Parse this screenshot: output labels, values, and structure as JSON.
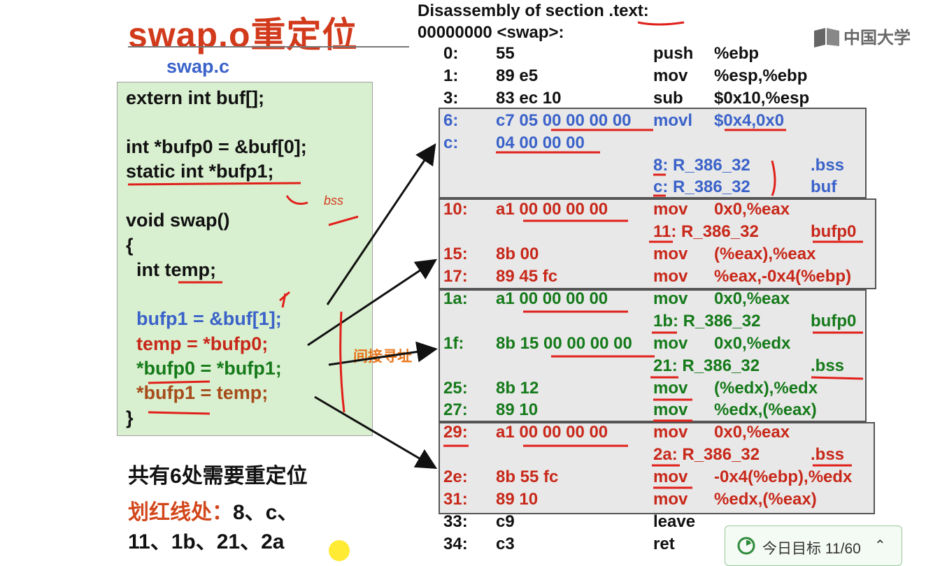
{
  "slide": {
    "title": "swap.o重定位",
    "file_label": "swap.c",
    "code_lines": [
      {
        "text": "extern int buf[];",
        "color": "black"
      },
      {
        "text": "",
        "color": "black"
      },
      {
        "text": "int *bufp0 = &buf[0];",
        "color": "black"
      },
      {
        "text": "static int *bufp1;",
        "color": "black"
      },
      {
        "text": "",
        "color": "black"
      },
      {
        "text": "void swap()",
        "color": "black"
      },
      {
        "text": "{",
        "color": "black"
      },
      {
        "text": "  int temp;",
        "color": "black"
      },
      {
        "text": "",
        "color": "black"
      },
      {
        "text": "  bufp1 = &buf[1];",
        "color": "blue"
      },
      {
        "text": "  temp = *bufp0;",
        "color": "red"
      },
      {
        "text": "  *bufp0 = *bufp1;",
        "color": "green"
      },
      {
        "text": "  *bufp1 = temp;",
        "color": "brown"
      },
      {
        "text": "}",
        "color": "black"
      }
    ],
    "summary": "共有6处需要重定位",
    "reloc_label": "划红线处：",
    "reloc_items_1": "8、c、",
    "reloc_items_2": "11、1b、21、2a",
    "annotation_indirect": "间接寻址",
    "annotation_bss": "bss"
  },
  "disasm": {
    "header1": "Disassembly of section .text:",
    "header2": "00000000 <swap>:",
    "rows": [
      {
        "off": "0:",
        "bytes": "55",
        "op": "push",
        "args": "%ebp",
        "color": "black",
        "top": 0
      },
      {
        "off": "1:",
        "bytes": "89 e5",
        "op": "mov",
        "args": "%esp,%ebp",
        "color": "black"
      },
      {
        "off": "3:",
        "bytes": "83 ec 10",
        "op": "sub",
        "args": "$0x10,%esp",
        "color": "black"
      },
      {
        "off": "6:",
        "bytes": "c7 05 00 00 00 00",
        "op": "movl",
        "args": "$0x4,0x0",
        "color": "blue"
      },
      {
        "off": "c:",
        "bytes": "04 00 00 00",
        "op": "",
        "args": "",
        "color": "blue"
      },
      {
        "off": "",
        "bytes": "",
        "op": "8: R_386_32",
        "args": "",
        "sym": ".bss",
        "color": "blue"
      },
      {
        "off": "",
        "bytes": "",
        "op": "c: R_386_32",
        "args": "",
        "sym": "buf",
        "color": "blue"
      },
      {
        "off": "10:",
        "bytes": "a1 00 00 00 00",
        "op": "mov",
        "args": "0x0,%eax",
        "color": "red"
      },
      {
        "off": "",
        "bytes": "",
        "op": "11: R_386_32",
        "args": "",
        "sym": "bufp0",
        "color": "red"
      },
      {
        "off": "15:",
        "bytes": "8b 00",
        "op": "mov",
        "args": "(%eax),%eax",
        "color": "red"
      },
      {
        "off": "17:",
        "bytes": "89 45 fc",
        "op": "mov",
        "args": "%eax,-0x4(%ebp)",
        "color": "red"
      },
      {
        "off": "1a:",
        "bytes": "a1 00 00 00 00",
        "op": "mov",
        "args": "0x0,%eax",
        "color": "green"
      },
      {
        "off": "",
        "bytes": "",
        "op": "1b: R_386_32",
        "args": "",
        "sym": "bufp0",
        "color": "green"
      },
      {
        "off": "1f:",
        "bytes": "8b 15 00 00 00 00",
        "op": "mov",
        "args": "0x0,%edx",
        "color": "green"
      },
      {
        "off": "",
        "bytes": "",
        "op": "21: R_386_32",
        "args": "",
        "sym": ".bss",
        "color": "green"
      },
      {
        "off": "25:",
        "bytes": "8b 12",
        "op": "mov",
        "args": "(%edx),%edx",
        "color": "green"
      },
      {
        "off": "27:",
        "bytes": "89 10",
        "op": "mov",
        "args": "%edx,(%eax)",
        "color": "green"
      },
      {
        "off": "29:",
        "bytes": "a1 00 00 00 00",
        "op": "mov",
        "args": "0x0,%eax",
        "color": "red"
      },
      {
        "off": "",
        "bytes": "",
        "op": "2a: R_386_32",
        "args": "",
        "sym": ".bss",
        "color": "red"
      },
      {
        "off": "2e:",
        "bytes": "8b 55 fc",
        "op": "mov",
        "args": "-0x4(%ebp),%edx",
        "color": "red"
      },
      {
        "off": "31:",
        "bytes": "89 10",
        "op": "mov",
        "args": "%edx,(%eax)",
        "color": "red"
      },
      {
        "off": "33:",
        "bytes": "c9",
        "op": "leave",
        "args": "",
        "color": "black"
      },
      {
        "off": "34:",
        "bytes": "c3",
        "op": "ret",
        "args": "",
        "color": "black"
      }
    ]
  },
  "logo": {
    "text": "中国大学"
  },
  "goal_widget": {
    "label": "今日目标 11/60",
    "progress": 0.18
  },
  "colors": {
    "title": "#d23a1c",
    "blue": "#3a62c9",
    "red": "#c8281a",
    "green": "#157a1a",
    "brown": "#a64b1a",
    "accent": "#e8761a"
  }
}
